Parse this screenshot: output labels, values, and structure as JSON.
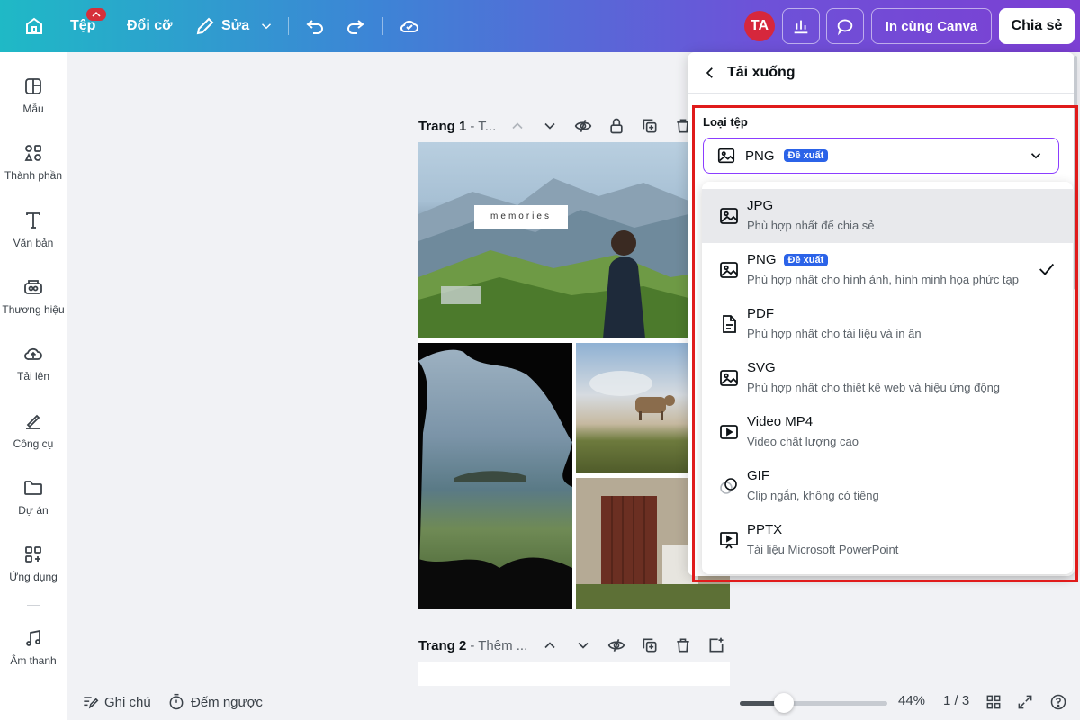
{
  "topbar": {
    "file_label": "Tệp",
    "file_badge": "",
    "resize_label": "Đổi cỡ",
    "edit_label": "Sửa",
    "avatar_initials": "TA",
    "print_label": "In cùng Canva",
    "share_label": "Chia sẻ"
  },
  "sidebar": {
    "items": [
      {
        "label": "Mẫu",
        "icon": "template-icon"
      },
      {
        "label": "Thành phần",
        "icon": "elements-icon"
      },
      {
        "label": "Văn bản",
        "icon": "text-icon"
      },
      {
        "label": "Thương hiệu",
        "icon": "brand-icon"
      },
      {
        "label": "Tải lên",
        "icon": "upload-icon"
      },
      {
        "label": "Công cụ",
        "icon": "tools-icon"
      },
      {
        "label": "Dự án",
        "icon": "folder-icon"
      },
      {
        "label": "Ứng dụng",
        "icon": "apps-icon"
      },
      {
        "label": "Âm thanh",
        "icon": "music-icon"
      }
    ]
  },
  "canvas": {
    "page1": {
      "name": "Trang 1",
      "title": "- T..."
    },
    "page2": {
      "name": "Trang 2",
      "title": "- Thêm ..."
    },
    "memories_text": "memories"
  },
  "bottombar": {
    "notes_label": "Ghi chú",
    "timer_label": "Đếm ngược",
    "zoom": "44%",
    "zoom_fraction": 0.3,
    "pages": "1 / 3"
  },
  "download": {
    "title": "Tải xuống",
    "filetype_label": "Loại tệp",
    "selected": "PNG",
    "selected_badge": "Đề xuất",
    "options": [
      {
        "name": "JPG",
        "desc": "Phù hợp nhất để chia sẻ",
        "icon": "image-icon",
        "badge": "",
        "checked": false,
        "highlighted": true
      },
      {
        "name": "PNG",
        "desc": "Phù hợp nhất cho hình ảnh, hình minh họa phức tạp",
        "icon": "image-icon",
        "badge": "Đề xuất",
        "checked": true,
        "highlighted": false
      },
      {
        "name": "PDF",
        "desc": "Phù hợp nhất cho tài liệu và in ấn",
        "icon": "document-icon",
        "badge": "",
        "checked": false,
        "highlighted": false
      },
      {
        "name": "SVG",
        "desc": "Phù hợp nhất cho thiết kế web và hiệu ứng động",
        "icon": "image-icon",
        "badge": "",
        "checked": false,
        "highlighted": false
      },
      {
        "name": "Video MP4",
        "desc": "Video chất lượng cao",
        "icon": "video-icon",
        "badge": "",
        "checked": false,
        "highlighted": false
      },
      {
        "name": "GIF",
        "desc": "Clip ngắn, không có tiếng",
        "icon": "gif-icon",
        "badge": "",
        "checked": false,
        "highlighted": false
      },
      {
        "name": "PPTX",
        "desc": "Tài liệu Microsoft PowerPoint",
        "icon": "presentation-icon",
        "badge": "",
        "checked": false,
        "highlighted": false
      }
    ]
  },
  "colors": {
    "accent": "#8b3dff",
    "badge": "#2b63e8",
    "highlight_border": "#e01b1b"
  }
}
